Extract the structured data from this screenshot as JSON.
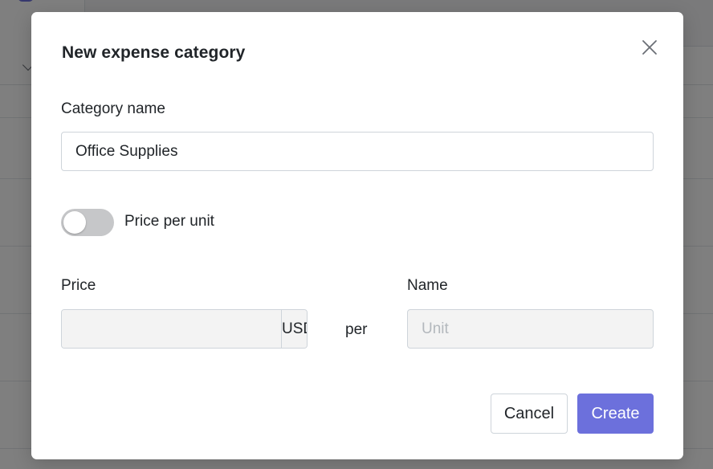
{
  "modal": {
    "title": "New expense category",
    "category_name": {
      "label": "Category name",
      "value": "Office Supplies"
    },
    "price_per_unit": {
      "label": "Price per unit",
      "enabled": false
    },
    "price": {
      "label": "Price",
      "value": "",
      "currency": "USD"
    },
    "per_text": "per",
    "unit_name": {
      "label": "Name",
      "placeholder": "Unit",
      "value": ""
    },
    "buttons": {
      "cancel": "Cancel",
      "create": "Create"
    },
    "icons": {
      "close": "close-icon"
    }
  },
  "colors": {
    "accent": "#6c70dc",
    "toggle_off": "#c6c7c9",
    "disabled_bg": "#f3f3f3",
    "backdrop": "rgba(0,0,0,0.5)"
  }
}
